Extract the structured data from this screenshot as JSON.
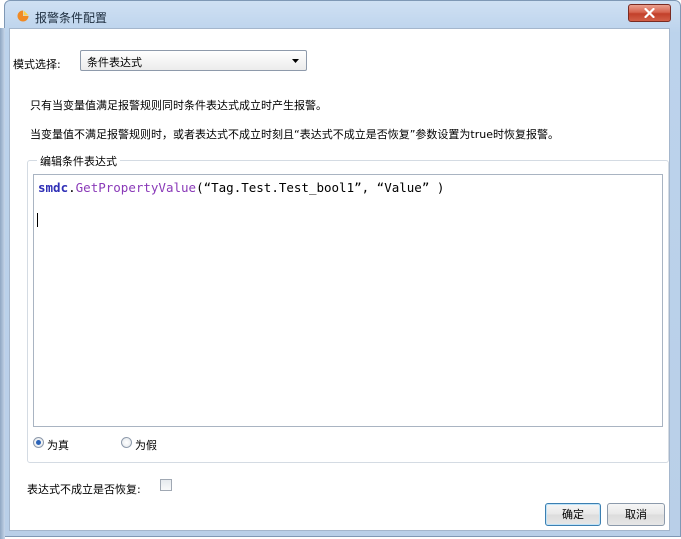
{
  "window": {
    "title": "报警条件配置"
  },
  "mode": {
    "label": "模式选择:",
    "selected": "条件表达式"
  },
  "info": {
    "line1": "只有当变量值满足报警规则同时条件表达式成立时产生报警。",
    "line2": "当变量值不满足报警规则时，或者表达式不成立时刻且“表达式不成立是否恢复”参数设置为true时恢复报警。"
  },
  "editor_group": {
    "title": "编辑条件表达式",
    "code_object": "smdc",
    "code_dot": ".",
    "code_method": "GetPropertyValue",
    "code_args": "(“Tag.Test.Test_bool1”, “Value” )"
  },
  "radios": {
    "true_label": "为真",
    "false_label": "为假",
    "selected": "为真"
  },
  "restore": {
    "label": "表达式不成立是否恢复:",
    "checked": false
  },
  "buttons": {
    "ok": "确定",
    "cancel": "取消"
  },
  "colors": {
    "keyword": "#2f2fb6",
    "method": "#8a3ab8",
    "close_button": "#c2402a"
  }
}
